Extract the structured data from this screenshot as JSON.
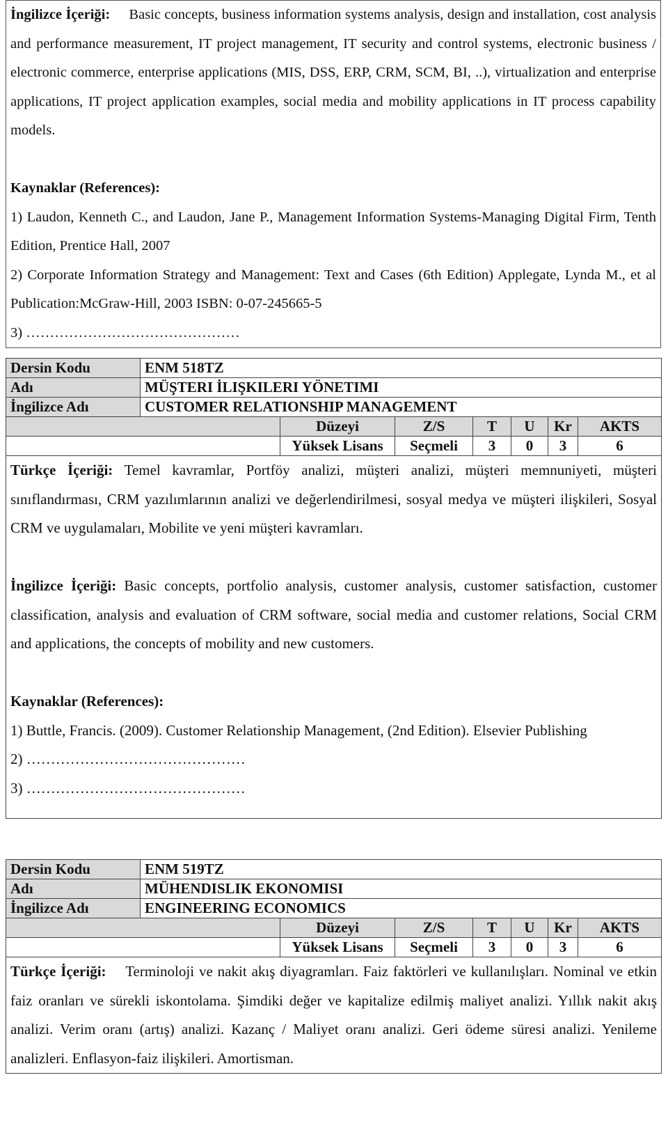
{
  "top_section": {
    "english_content_label": "İngilizce İçeriği:",
    "english_content_text": "Basic concepts, business information systems analysis, design and installation, cost analysis and performance measurement, IT project management, IT security and control systems, electronic business / electronic commerce, enterprise applications (MIS, DSS, ERP, CRM, SCM, BI, ..), virtualization and enterprise applications, IT project application examples, social media and mobility applications in IT process capability models.",
    "references_title": "Kaynaklar (References):",
    "references": [
      "1) Laudon, Kenneth C., and Laudon, Jane P., Management Information Systems-Managing Digital Firm, Tenth Edition, Prentice Hall, 2007",
      "2) Corporate Information Strategy and Management: Text and Cases (6th Edition) Applegate, Lynda M., et al Publication:McGraw-Hill, 2003 ISBN: 0-07-245665-5",
      "3) ………………………………………"
    ]
  },
  "labels": {
    "course_code": "Dersin Kodu",
    "name": "Adı",
    "english_name": "İngilizce Adı",
    "level": "Düzeyi",
    "type": "Z/S",
    "theory": "T",
    "practice": "U",
    "credit": "Kr",
    "ects": "AKTS",
    "turkish_content": "Türkçe İçeriği:",
    "english_content": "İngilizce İçeriği:",
    "references": "Kaynaklar (References):"
  },
  "courses": [
    {
      "code": "ENM 518TZ",
      "name": "MÜŞTERI İLIŞKILERI YÖNETIMI",
      "english_name": "CUSTOMER RELATIONSHIP MANAGEMENT",
      "level": "Yüksek Lisans",
      "type": "Seçmeli",
      "theory": "3",
      "practice": "0",
      "credit": "3",
      "ects": "6",
      "turkish_content": "Temel kavramlar, Portföy analizi, müşteri analizi, müşteri memnuniyeti, müşteri sınıflandırması, CRM yazılımlarının analizi ve değerlendirilmesi, sosyal medya ve müşteri ilişkileri, Sosyal CRM ve uygulamaları, Mobilite ve yeni müşteri kavramları.",
      "english_content": "Basic concepts, portfolio analysis, customer analysis, customer satisfaction, customer classification, analysis and evaluation of CRM software, social media and customer relations, Social CRM and applications, the concepts of mobility and new customers.",
      "references": [
        "1) Buttle, Francis. (2009). Customer Relationship Management, (2nd Edition). Elsevier Publishing",
        "2) ………………………………………",
        "3) ………………………………………"
      ]
    },
    {
      "code": "ENM 519TZ",
      "name": "MÜHENDISLIK EKONOMISI",
      "english_name": "ENGINEERING ECONOMICS",
      "level": "Yüksek Lisans",
      "type": "Seçmeli",
      "theory": "3",
      "practice": "0",
      "credit": "3",
      "ects": "6",
      "turkish_content": "Terminoloji ve nakit akış diyagramları. Faiz faktörleri ve kullanılışları. Nominal ve etkin faiz oranları ve sürekli iskontolama. Şimdiki değer ve kapitalize edilmiş maliyet analizi. Yıllık nakit akış analizi. Verim oranı (artış) analizi. Kazanç / Maliyet oranı analizi. Geri ödeme süresi analizi. Yenileme analizleri. Enflasyon-faiz ilişkileri. Amortisman."
    }
  ]
}
